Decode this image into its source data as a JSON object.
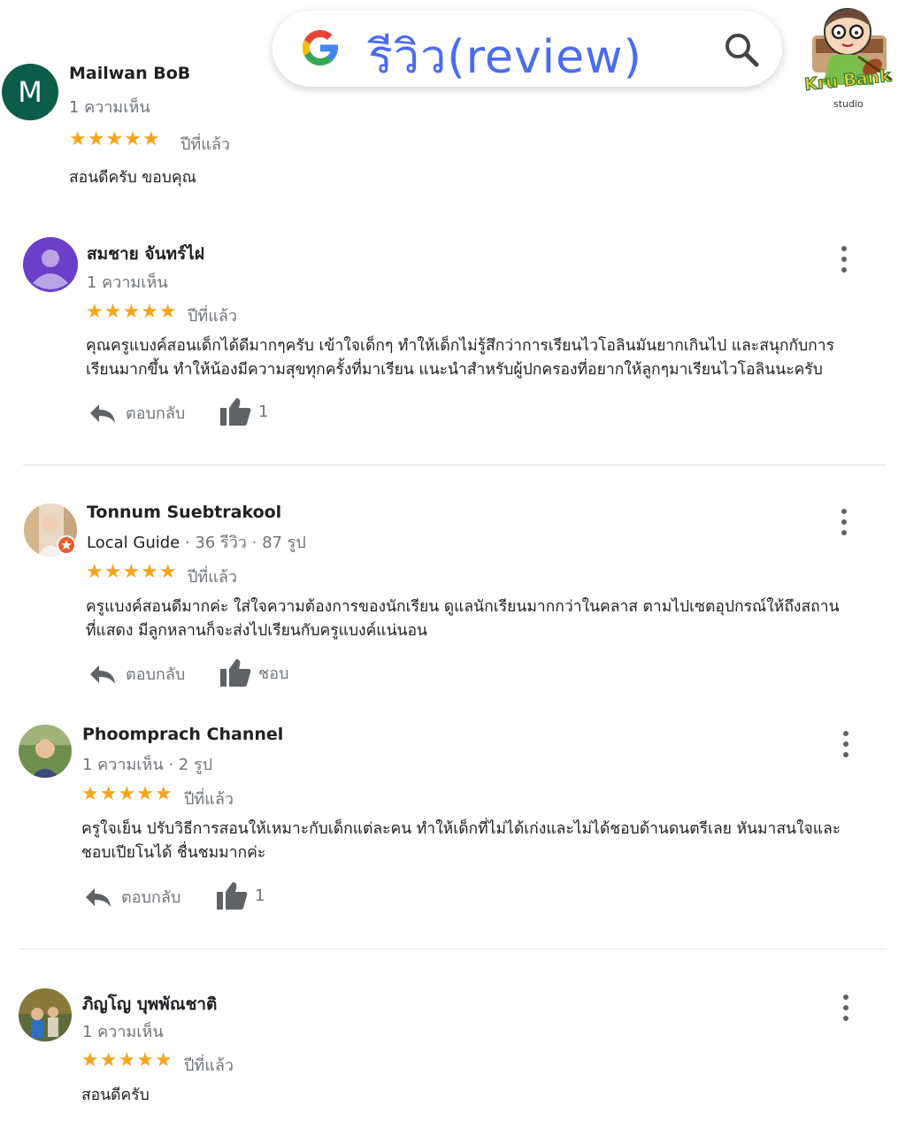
{
  "header": {
    "search_text": "รีวิว(review)",
    "logo_text_main": "Kru Bank",
    "logo_text_sub": "studio"
  },
  "common": {
    "reply_label": "ตอบกลับ",
    "like_label": "ชอบ"
  },
  "reviews": [
    {
      "name": "Mailwan BoB",
      "avatar_letter": "M",
      "meta": "1 ความเห็น",
      "stars": "★★★★★",
      "time": "ปีที่แล้ว",
      "text": "สอนดีครับ ขอบคุณ"
    },
    {
      "name": "สมชาย จันทร์ไฝ",
      "meta": "1 ความเห็น",
      "stars": "★★★★★",
      "time": "ปีที่แล้ว",
      "text_line1": "คุณครูแบงค์สอนเด็กได้ดีมากๆครับ เข้าใจเด็กๆ ทำให้เด็กไม่รู้สึกว่าการเรียนไวโอลินมันยากเกินไป และสนุกกับการ",
      "text_line2": "เรียนมากขึ้น ทำให้น้องมีความสุขทุกครั้งที่มาเรียน แนะนำสำหรับผู้ปกครองที่อยากให้ลูกๆมาเรียนไวโอลินนะครับ",
      "likes": "1"
    },
    {
      "name": "Tonnum Suebtrakool",
      "meta_guide": "Local Guide",
      "meta_rest": " · 36 รีวิว · 87 รูป",
      "stars": "★★★★★",
      "time": "ปีที่แล้ว",
      "text_line1": "ครูแบงค์สอนดีมากค่ะ ใส่ใจความต้องการของนักเรียน ดูแลนักเรียนมากกว่าในคลาส ตามไปเซตอุปกรณ์ให้ถึงสถาน",
      "text_line2": "ที่แสดง มีลูกหลานก็จะส่งไปเรียนกับครูแบงค์แน่นอน"
    },
    {
      "name": "Phoomprach Channel",
      "meta": "1 ความเห็น · 2 รูป",
      "stars": "★★★★★",
      "time": "ปีที่แล้ว",
      "text_line1": "ครูใจเย็น ปรับวิธีการสอนให้เหมาะกับเด็กแต่ละคน ทำให้เด็กที่ไม่ได้เก่งและไม่ได้ชอบด้านดนตรีเลย หันมาสนใจและ",
      "text_line2": "ชอบเปียโนได้ ชื่นชมมากค่ะ",
      "likes": "1"
    },
    {
      "name": "ภิญโญ บุพพัณชาติ",
      "meta": "1 ความเห็น",
      "stars": "★★★★★",
      "time": "ปีที่แล้ว",
      "text": "สอนดีครับ"
    }
  ],
  "colors": {
    "star": "#f6a41b",
    "search_text": "#4a6cf0",
    "avatar_m": "#0b5c4a",
    "avatar_purple": "#6a3fc9"
  }
}
